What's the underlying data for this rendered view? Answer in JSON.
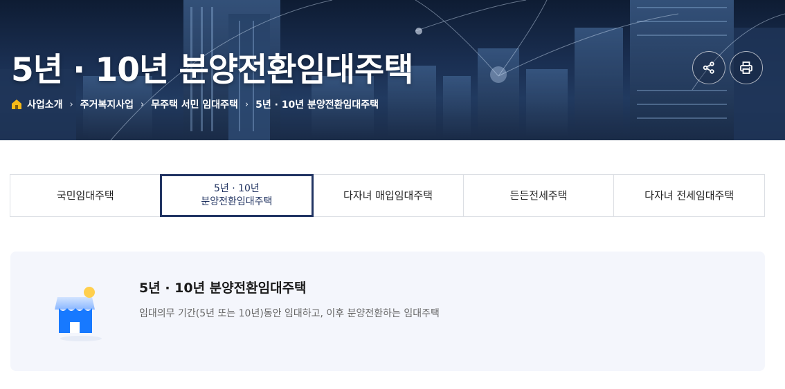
{
  "hero": {
    "title": "5년 · 10년 분양전환임대주택",
    "breadcrumb": [
      "사업소개",
      "주거복지사업",
      "무주택 서민 임대주택",
      "5년 · 10년 분양전환임대주택"
    ],
    "separator": "›"
  },
  "tabs": [
    {
      "line1": "국민임대주택",
      "line2": ""
    },
    {
      "line1": "5년 · 10년",
      "line2": "분양전환임대주택"
    },
    {
      "line1": "다자녀 매입임대주택",
      "line2": ""
    },
    {
      "line1": "든든전세주택",
      "line2": ""
    },
    {
      "line1": "다자녀 전세임대주택",
      "line2": ""
    }
  ],
  "active_tab": 1,
  "info": {
    "title": "5년 · 10년 분양전환임대주택",
    "description": "임대의무 기간(5년 또는 10년)동안 임대하고, 이후 분양전환하는 임대주택",
    "icon": "house-icon"
  },
  "icons": {
    "home": "home-icon",
    "share": "share-icon",
    "print": "print-icon"
  },
  "colors": {
    "active_tab_border": "#213463",
    "info_box_bg": "#f4f6fc",
    "house_blue": "#1779ff",
    "home_icon": "#f5b918"
  }
}
